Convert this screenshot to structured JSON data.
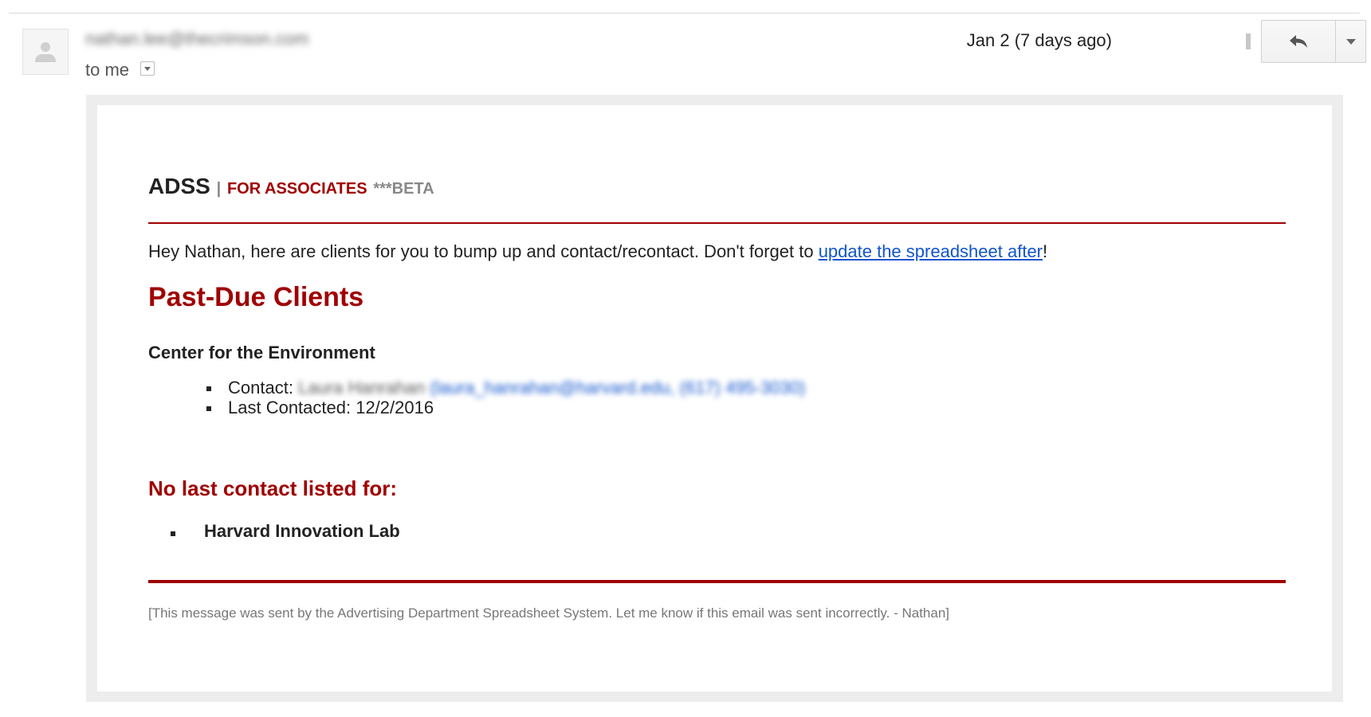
{
  "message": {
    "sender": "nathan.lee@thecrimson.com",
    "recipient": "to me",
    "date": "Jan 2 (7 days ago)"
  },
  "body": {
    "brand": {
      "name": "ADSS",
      "separator": "|",
      "audience": "FOR ASSOCIATES",
      "beta": "***BETA"
    },
    "intro": {
      "text": "Hey Nathan, here are clients for you to bump up and contact/recontact. Don't forget to ",
      "link": "update the spreadsheet after",
      "end": "!"
    },
    "past_due": {
      "heading": "Past-Due Clients",
      "client": "Center for the Environment",
      "contact_label": "Contact:",
      "contact_name": "Laura Hanrahan",
      "contact_link": "(laura_hanrahan@harvard.edu, (617) 495-3030)",
      "last_contacted": "Last Contacted: 12/2/2016"
    },
    "no_contact": {
      "heading": "No last contact listed for:",
      "items": [
        "Harvard Innovation Lab"
      ]
    },
    "footer": "[This message was sent by the Advertising Department Spreadsheet System. Let me know if this email was sent incorrectly. - Nathan]"
  },
  "icons": {
    "avatar": "default-avatar-icon",
    "reply": "reply-arrow-icon",
    "more": "chevron-down-icon",
    "recipient_details": "chevron-down-icon"
  },
  "colors": {
    "accent": "#a00000",
    "link": "#1155cc"
  }
}
